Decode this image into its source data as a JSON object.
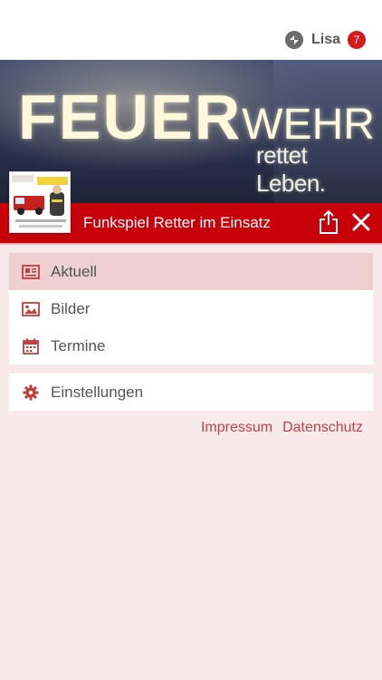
{
  "header": {
    "user_name": "Lisa",
    "notification_count": "7",
    "icons": {
      "brand": "app-logo-icon"
    }
  },
  "hero": {
    "title_main": "FEUER",
    "title_rest": "WEHR",
    "subtitle": "rettet Leben."
  },
  "titlebar": {
    "title": "Funkspiel Retter im Einsatz",
    "icons": {
      "share": "share-icon",
      "close": "close-icon"
    }
  },
  "menu": {
    "items": [
      {
        "label": "Aktuell",
        "icon": "newspaper-icon",
        "active": true
      },
      {
        "label": "Bilder",
        "icon": "image-icon",
        "active": false
      },
      {
        "label": "Termine",
        "icon": "calendar-icon",
        "active": false
      }
    ],
    "settings": {
      "label": "Einstellungen",
      "icon": "gear-icon"
    }
  },
  "footer": {
    "impressum": "Impressum",
    "datenschutz": "Datenschutz"
  },
  "colors": {
    "accent": "#c8000a",
    "badge": "#d9191e",
    "background": "#f8eaea",
    "active_item": "#eed0d0",
    "link": "#b8434d",
    "icon": "#c04040"
  }
}
